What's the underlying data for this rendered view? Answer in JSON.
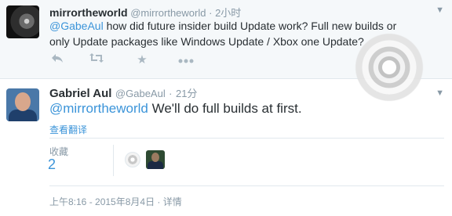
{
  "tweet1": {
    "name": "mirrortheworld",
    "handle": "@mirrortheworld",
    "separator": "·",
    "time": "2小时",
    "mention": "@GabeAul",
    "text": " how did future insider build Update work? Full new builds or only Update packages like Windows Update / Xbox one Update?",
    "actions": [
      {
        "icon": "reply-icon"
      },
      {
        "icon": "retweet-icon"
      },
      {
        "icon": "favorite-star-icon"
      },
      {
        "icon": "more-icon"
      }
    ]
  },
  "tweet2": {
    "name": "Gabriel Aul",
    "handle": "@GabeAul",
    "separator": "·",
    "time": "21分",
    "mention": "@mirrortheworld",
    "text": " We'll do full builds at first.",
    "translate": "查看翻译",
    "stats_label": "收藏",
    "stats_value": "2",
    "timestamp": "上午8:16 - 2015年8月4日",
    "details_sep": " · ",
    "details": "详情"
  },
  "colors": {
    "link": "#3b94d9",
    "muted": "#8899a6",
    "text": "#292f33",
    "highlight_bg": "#f5f8fa"
  }
}
